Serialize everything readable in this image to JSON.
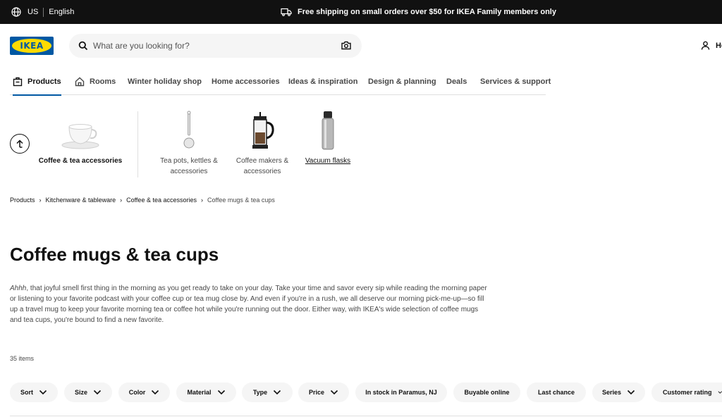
{
  "topbar": {
    "country": "US",
    "language": "English",
    "promo": "Free shipping on small orders over $50 for IKEA Family members only"
  },
  "header": {
    "logo_text": "IKEA",
    "search_placeholder": "What are you looking for?",
    "account_label": "He"
  },
  "nav": {
    "items": [
      {
        "label": "Products"
      },
      {
        "label": "Rooms"
      },
      {
        "label": "Winter holiday shop"
      },
      {
        "label": "Home accessories"
      },
      {
        "label": "Ideas & inspiration"
      },
      {
        "label": "Design & planning"
      },
      {
        "label": "Deals"
      },
      {
        "label": "Services & support"
      }
    ]
  },
  "categories": {
    "current": "Coffee & tea accessories",
    "items": [
      {
        "line1": "Tea pots, kettles &",
        "line2": "accessories"
      },
      {
        "line1": "Coffee makers &",
        "line2": "accessories"
      },
      {
        "line1": "Vacuum flasks",
        "line2": ""
      }
    ]
  },
  "breadcrumb": [
    "Products",
    "Kitchenware & tableware",
    "Coffee & tea accessories",
    "Coffee mugs & tea cups"
  ],
  "page": {
    "title": "Coffee mugs & tea cups",
    "desc_italic": "Ahhh",
    "desc_rest": ", that joyful smell first thing in the morning as you get ready to take on your day. Take your time and savor every sip while reading the morning paper or listening to your favorite podcast with your coffee cup or tea mug close by. And even if you're in a rush, we all deserve our morning pick-me-up—so fill up a travel mug to keep your favorite morning tea or coffee hot while you're running out the door. Either way, with IKEA's wide selection of coffee mugs and tea cups, you're bound to find a new favorite.",
    "item_count": "35 items"
  },
  "filters": [
    {
      "label": "Sort"
    },
    {
      "label": "Size"
    },
    {
      "label": "Color"
    },
    {
      "label": "Material"
    },
    {
      "label": "Type"
    },
    {
      "label": "Price"
    },
    {
      "label": "In stock in Paramus, NJ"
    },
    {
      "label": "Buyable online"
    },
    {
      "label": "Last chance"
    },
    {
      "label": "Series"
    },
    {
      "label": "Customer rating"
    }
  ],
  "colors": {
    "brand_blue": "#0058a3",
    "brand_yellow": "#ffdb00",
    "topbar_bg": "#111111",
    "pill_bg": "#f5f5f5"
  }
}
